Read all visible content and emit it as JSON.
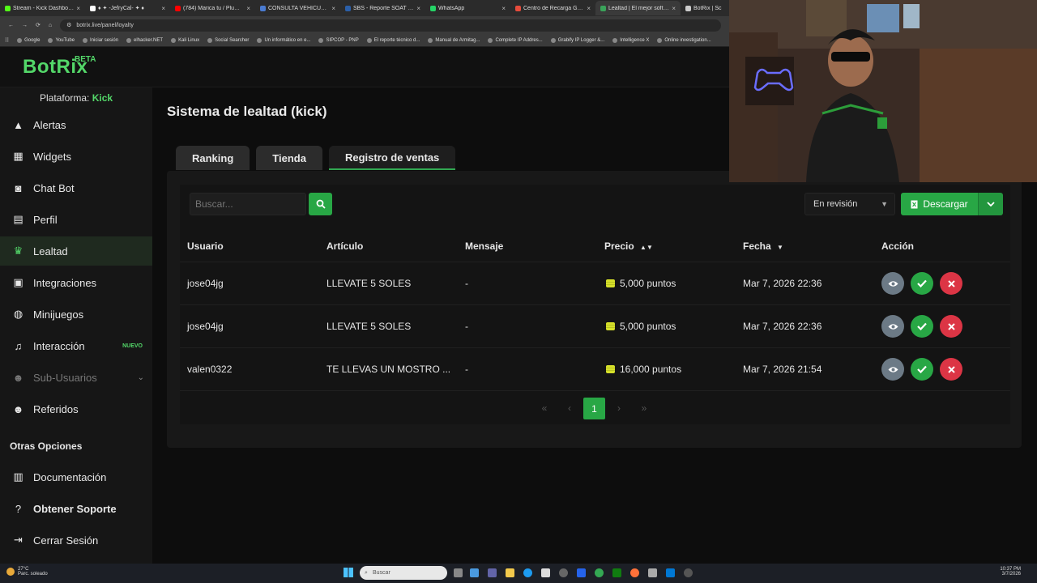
{
  "browser": {
    "tabs": [
      {
        "label": "Stream - Kick Dashboard",
        "color": "#53fc18"
      },
      {
        "label": "♦ ✦ -JefryCal- ✦ ♦",
        "color": "#ffffff"
      },
      {
        "label": "(784) Marica tu / Pluma G",
        "color": "#ff0000"
      },
      {
        "label": "CONSULTA VEHICULAR",
        "color": "#4a7bd1"
      },
      {
        "label": "SBS - Reporte SOAT / CA",
        "color": "#2b5fa8"
      },
      {
        "label": "WhatsApp",
        "color": "#25d366"
      },
      {
        "label": "Centro de Recarga Garena",
        "color": "#e74c3c"
      },
      {
        "label": "Lealtad | El mejor softwa",
        "color": "#3aa35a",
        "active": true
      },
      {
        "label": "BotRix | Sc",
        "color": "#cccccc"
      }
    ],
    "url": "botrix.live/panel/loyalty",
    "bookmarks": [
      "Google",
      "YouTube",
      "Iniciar sesión",
      "elhacker.NET",
      "Kali Linux",
      "Social Searcher",
      "Un informático en e...",
      "SIPCOP - PNP",
      "El reporte técnico d...",
      "Manual de Armitag...",
      "Complete IP Addres...",
      "Grabify IP Logger &...",
      "Intelligence X",
      "Online investigation..."
    ]
  },
  "brand": {
    "logo": "BotRix",
    "badge": "BETA",
    "accent": "#53d769"
  },
  "sidebar": {
    "platform_label": "Plataforma:",
    "platform_value": "Kick",
    "items": [
      {
        "label": "Alertas",
        "icon": "warning-icon"
      },
      {
        "label": "Widgets",
        "icon": "grid-icon"
      },
      {
        "label": "Chat Bot",
        "icon": "robot-icon"
      },
      {
        "label": "Perfil",
        "icon": "id-card-icon"
      },
      {
        "label": "Lealtad",
        "icon": "trophy-icon",
        "active": true
      },
      {
        "label": "Integraciones",
        "icon": "plug-icon"
      },
      {
        "label": "Minijuegos",
        "icon": "gamepad-icon"
      },
      {
        "label": "Interacción",
        "icon": "music-icon",
        "badge": "NUEVO"
      },
      {
        "label": "Sub-Usuarios",
        "icon": "users-icon",
        "muted": true
      },
      {
        "label": "Referidos",
        "icon": "user-group-icon"
      }
    ],
    "other_title": "Otras Opciones",
    "other": [
      {
        "label": "Documentación",
        "icon": "book-icon"
      },
      {
        "label": "Obtener Soporte",
        "icon": "question-icon"
      },
      {
        "label": "Cerrar Sesión",
        "icon": "logout-icon"
      }
    ]
  },
  "page": {
    "title": "Sistema de lealtad (kick)",
    "tabs": [
      "Ranking",
      "Tienda",
      "Registro de ventas"
    ],
    "search_placeholder": "Buscar...",
    "filter": "En revisión",
    "download": "Descargar"
  },
  "table": {
    "headers": [
      "Usuario",
      "Artículo",
      "Mensaje",
      "Precio",
      "Fecha",
      "Acción"
    ],
    "rows": [
      {
        "user": "jose04jg",
        "item": "LLEVATE 5 SOLES",
        "msg": "-",
        "price": "5,000 puntos",
        "date": "Mar 7, 2026 22:36"
      },
      {
        "user": "jose04jg",
        "item": "LLEVATE 5 SOLES",
        "msg": "-",
        "price": "5,000 puntos",
        "date": "Mar 7, 2026 22:36"
      },
      {
        "user": "valen0322",
        "item": "TE LLEVAS UN MOSTRO ...",
        "msg": "-",
        "price": "16,000 puntos",
        "date": "Mar 7, 2026 21:54"
      }
    ],
    "current_page": "1"
  },
  "taskbar": {
    "weather_temp": "27°C",
    "weather_desc": "Parc. soleado",
    "search": "Buscar",
    "time": "10:37 PM",
    "date": "3/7/2026"
  }
}
